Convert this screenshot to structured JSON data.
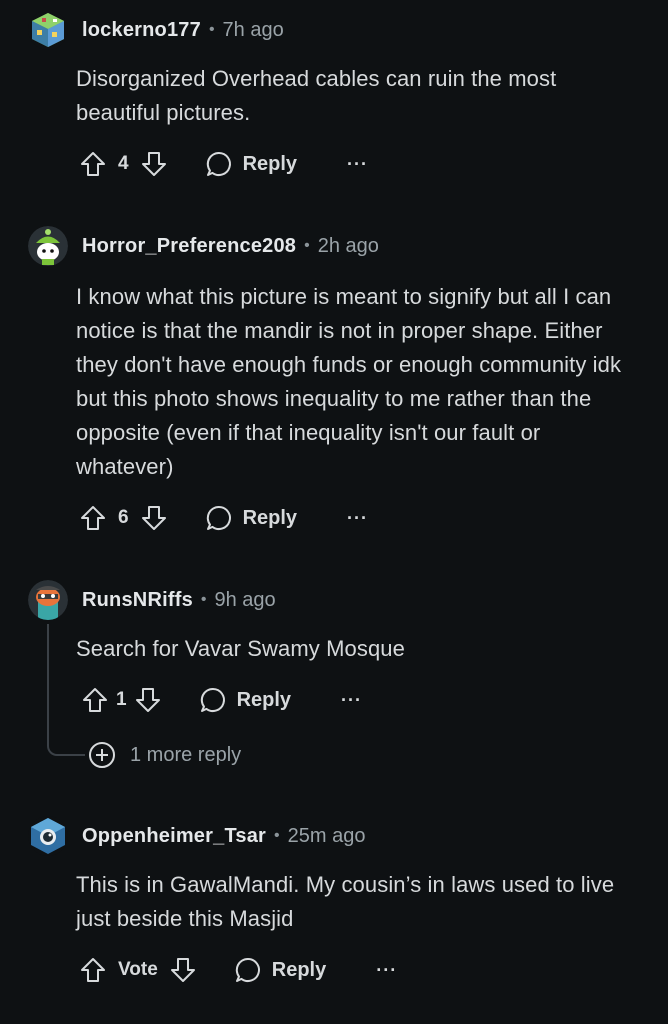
{
  "comments": [
    {
      "author": "lockerno177",
      "time": "7h ago",
      "text": "Disorganized Overhead cables can ruin the most beautiful pictures.",
      "votes": "4",
      "reply_label": "Reply",
      "more_label": "···",
      "avatar_icon": "pixel-cube-avatar-icon"
    },
    {
      "author": "Horror_Preference208",
      "time": "2h ago",
      "text": "I know what this picture is meant to signify but all I can notice is that the mandir is not in proper shape. Either they don't have enough funds or enough community idk but this photo shows inequality to me rather than the opposite (even if that inequality isn't our fault or whatever)",
      "votes": "6",
      "reply_label": "Reply",
      "more_label": "···",
      "avatar_icon": "snoo-avatar-icon"
    },
    {
      "author": "RunsNRiffs",
      "time": "9h ago",
      "text": "Search for Vavar Swamy Mosque",
      "votes": "1",
      "reply_label": "Reply",
      "more_label": "···",
      "avatar_icon": "snoo-orange-avatar-icon"
    },
    {
      "author": "Oppenheimer_Tsar",
      "time": "25m ago",
      "text": "This is in GawalMandi. My cousin’s in laws used to live just beside this Masjid",
      "votes": "Vote",
      "reply_label": "Reply",
      "more_label": "···",
      "avatar_icon": "astronaut-avatar-icon"
    }
  ],
  "more_replies": {
    "label": "1 more reply"
  },
  "colors": {
    "background": "#0e1113",
    "text": "#d7dadc",
    "muted": "#9aa3a8",
    "thread_line": "#3b4147"
  }
}
